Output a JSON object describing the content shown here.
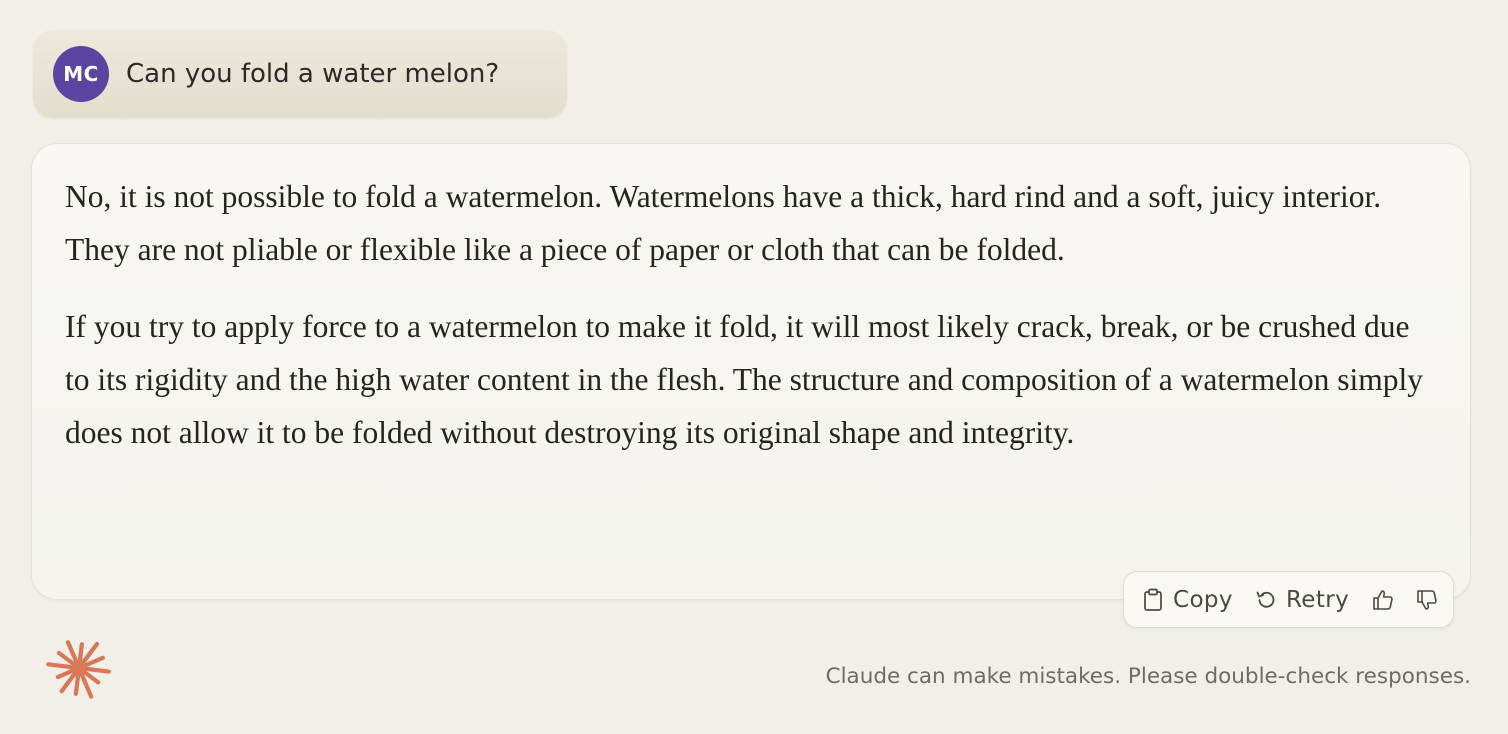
{
  "user_message": {
    "avatar_initials": "MC",
    "text": "Can you fold a water melon?"
  },
  "assistant_message": {
    "paragraphs": [
      "No, it is not possible to fold a watermelon. Watermelons have a thick, hard rind and a soft, juicy interior. They are not pliable or flexible like a piece of paper or cloth that can be folded.",
      "If you try to apply force to a watermelon to make it fold, it will most likely crack, break, or be crushed due to its rigidity and the high water content in the flesh. The structure and composition of a watermelon simply does not allow it to be folded without destroying its original shape and integrity."
    ]
  },
  "actions": {
    "copy_label": "Copy",
    "retry_label": "Retry",
    "thumbs_up_icon": "thumbs-up-icon",
    "thumbs_down_icon": "thumbs-down-icon"
  },
  "footer": {
    "logo_icon": "claude-starburst-icon",
    "disclaimer": "Claude can make mistakes. Please double-check responses."
  },
  "colors": {
    "background": "#f1efe8",
    "avatar": "#5a45a3",
    "logo": "#d97757",
    "text": "#25241f"
  }
}
